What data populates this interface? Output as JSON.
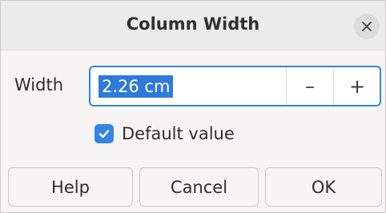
{
  "dialog": {
    "title": "Column Width",
    "close_icon": "close-icon"
  },
  "width_field": {
    "label": "Width",
    "value": "2.26 cm",
    "decrement_symbol": "–",
    "increment_symbol": "+"
  },
  "default_value": {
    "label": "Default value",
    "checked": true
  },
  "buttons": {
    "help": "Help",
    "cancel": "Cancel",
    "ok": "OK"
  },
  "colors": {
    "accent": "#3584e4",
    "selection": "#2f7ad8"
  }
}
